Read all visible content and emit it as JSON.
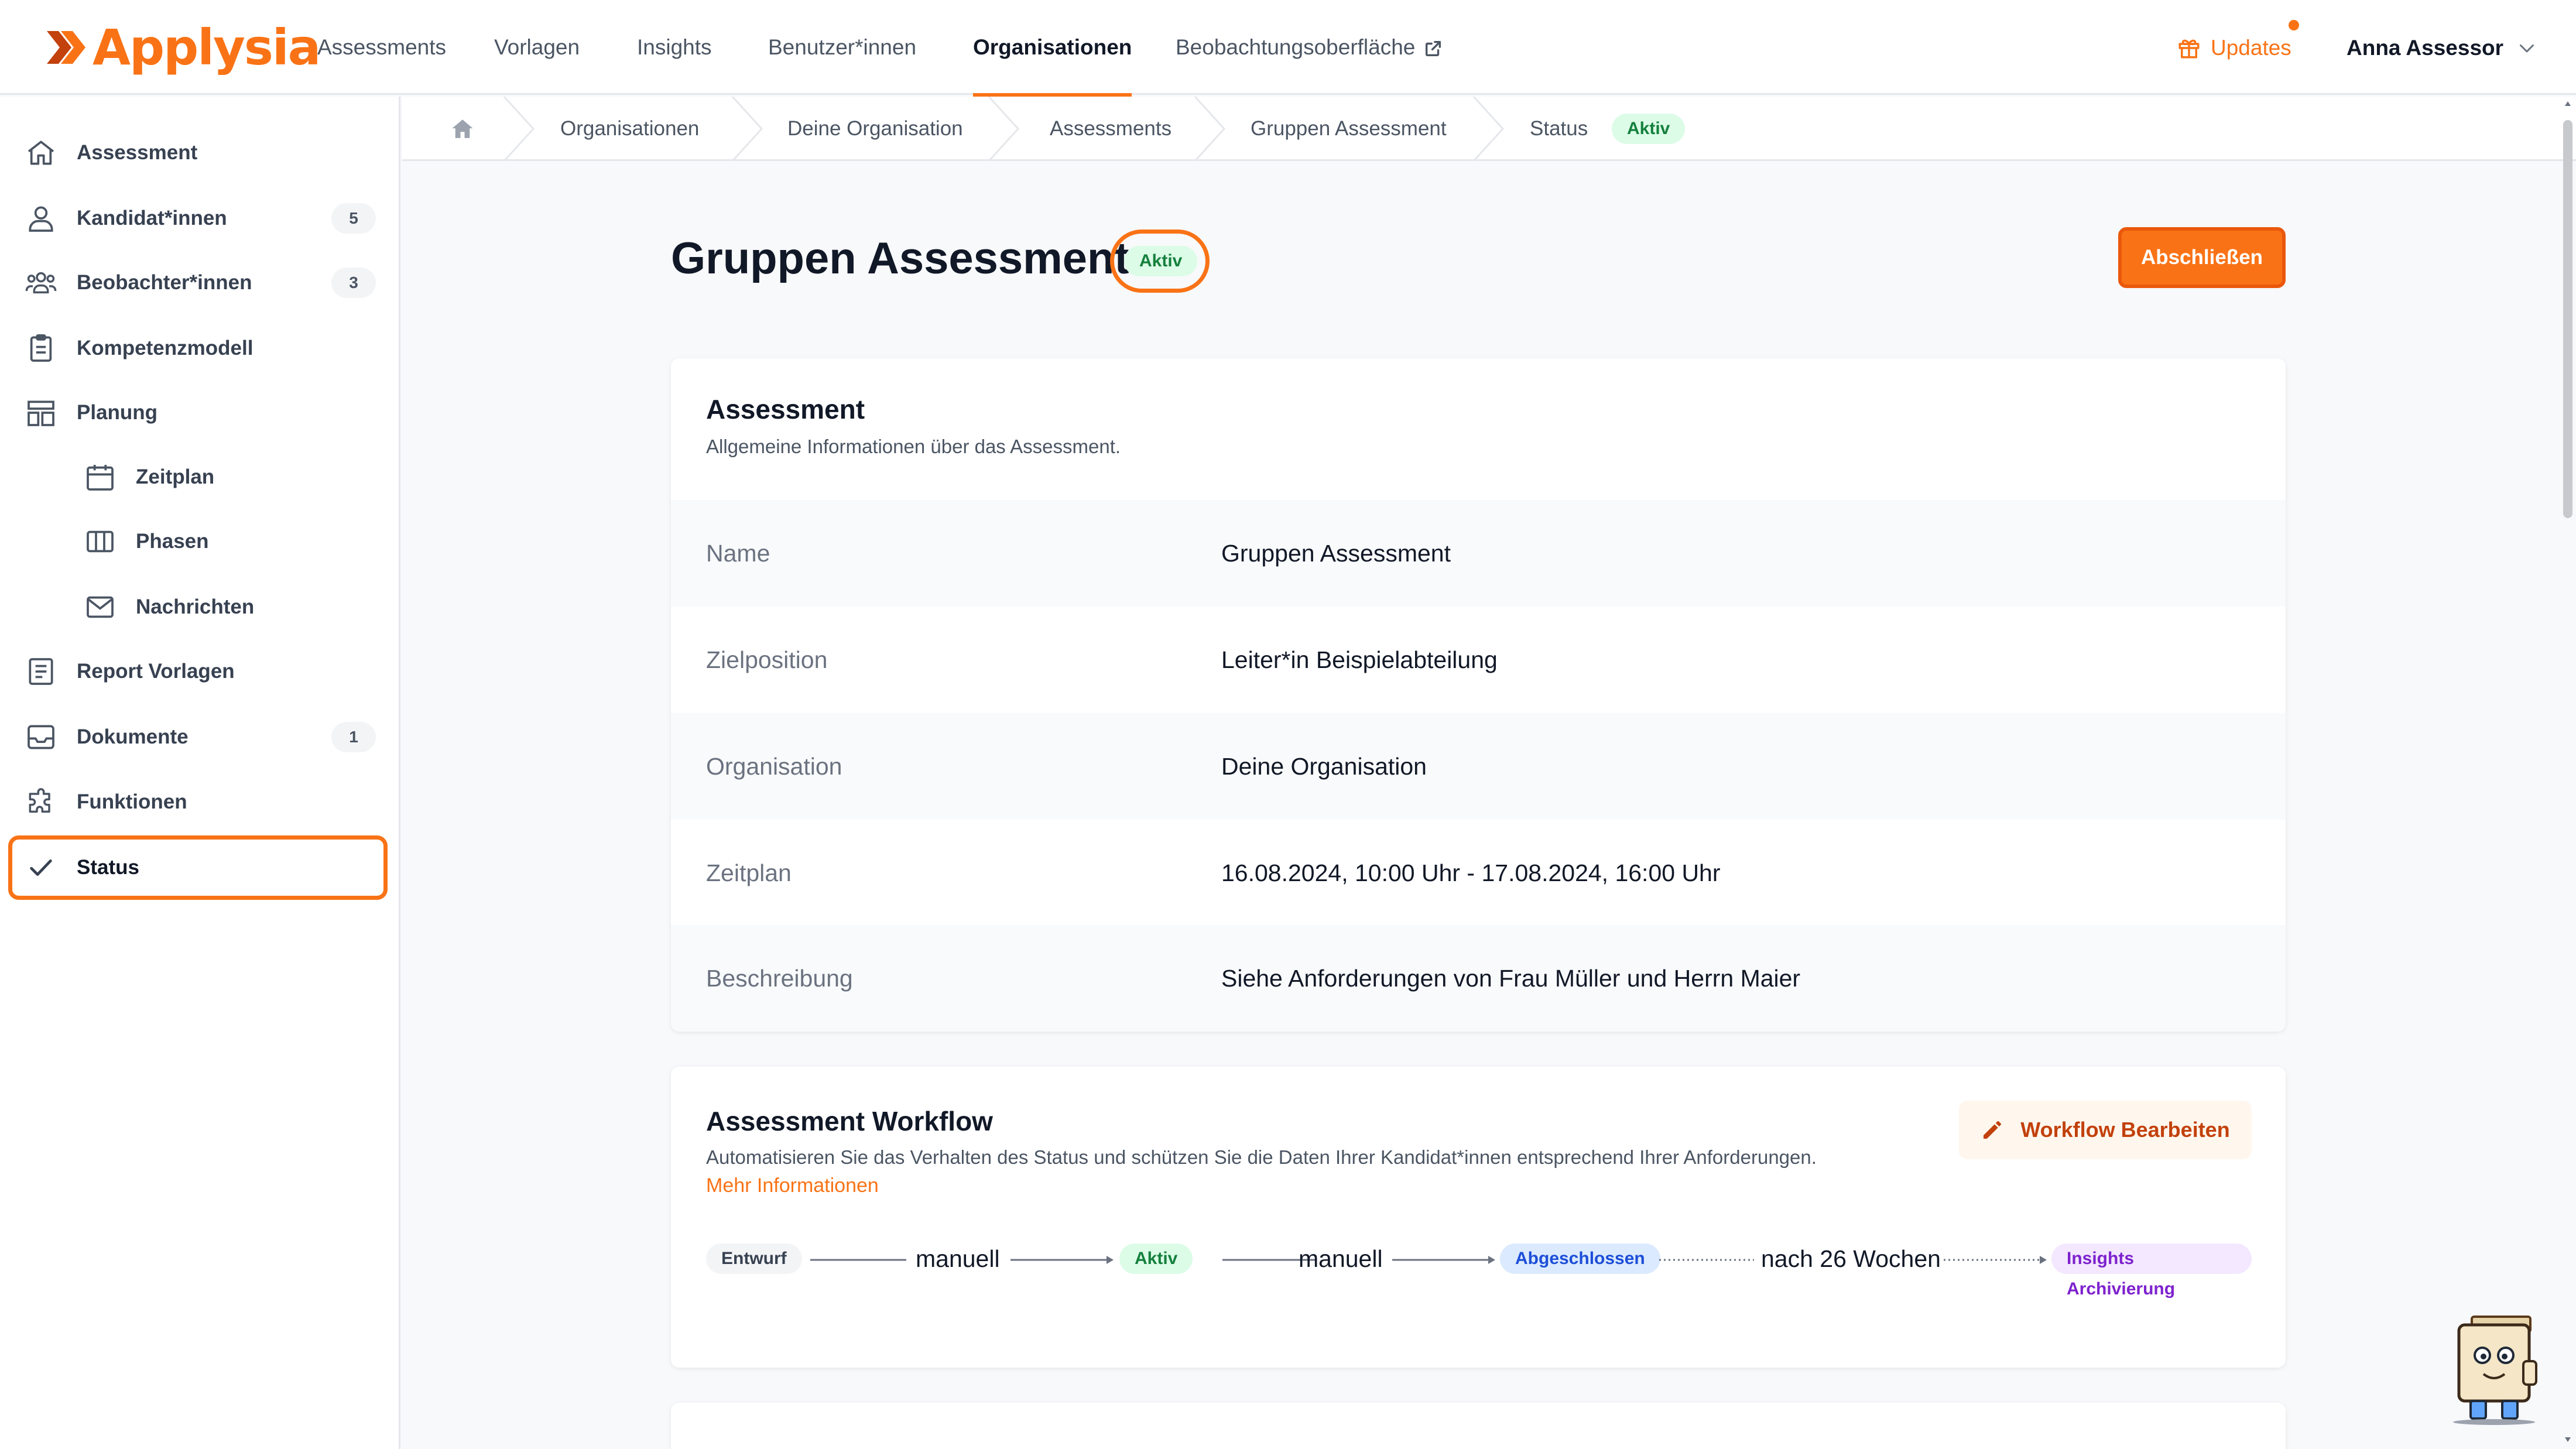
{
  "brand": {
    "name_first": "A",
    "name_rest": "pplysia",
    "accent": "#f97316"
  },
  "topnav": {
    "items": [
      "Assessments",
      "Vorlagen",
      "Insights",
      "Benutzer*innen",
      "Organisationen",
      "Beobachtungsoberfläche"
    ],
    "active": "Organisationen",
    "updates_label": "Updates",
    "user_name": "Anna Assessor"
  },
  "sidebar": {
    "items": [
      {
        "label": "Assessment",
        "icon": "home-icon"
      },
      {
        "label": "Kandidat*innen",
        "icon": "user-icon",
        "badge": "5"
      },
      {
        "label": "Beobachter*innen",
        "icon": "users-icon",
        "badge": "3"
      },
      {
        "label": "Kompetenzmodell",
        "icon": "clipboard-icon"
      },
      {
        "label": "Planung",
        "icon": "layout-icon"
      },
      {
        "label": "Zeitplan",
        "icon": "calendar-icon"
      },
      {
        "label": "Phasen",
        "icon": "columns-icon"
      },
      {
        "label": "Nachrichten",
        "icon": "mail-icon"
      },
      {
        "label": "Report Vorlagen",
        "icon": "report-icon"
      },
      {
        "label": "Dokumente",
        "icon": "inbox-icon",
        "badge": "1"
      },
      {
        "label": "Funktionen",
        "icon": "puzzle-icon"
      },
      {
        "label": "Status",
        "icon": "check-icon"
      }
    ],
    "active": "Status"
  },
  "breadcrumb": {
    "items": [
      "Organisationen",
      "Deine Organisation",
      "Assessments",
      "Gruppen Assessment",
      "Status"
    ],
    "status_pill": "Aktiv"
  },
  "page": {
    "title": "Gruppen Assessment",
    "status_pill": "Aktiv",
    "finish_button": "Abschließen"
  },
  "assessment_card": {
    "title": "Assessment",
    "subtitle": "Allgemeine Informationen über das Assessment.",
    "rows": [
      {
        "key": "Name",
        "value": "Gruppen Assessment"
      },
      {
        "key": "Zielposition",
        "value": "Leiter*in Beispielabteilung"
      },
      {
        "key": "Organisation",
        "value": "Deine Organisation"
      },
      {
        "key": "Zeitplan",
        "value": "16.08.2024, 10:00 Uhr - 17.08.2024, 16:00 Uhr"
      },
      {
        "key": "Beschreibung",
        "value": "Siehe Anforderungen von Frau Müller und Herrn Maier"
      }
    ]
  },
  "workflow_card": {
    "title": "Assessment Workflow",
    "subtitle": "Automatisieren Sie das Verhalten des Status und schützen Sie die Daten Ihrer Kandidat*innen entsprechend Ihrer Anforderungen.",
    "more_link": "Mehr Informationen",
    "edit_button": "Workflow Bearbeiten",
    "flow": {
      "states": [
        "Entwurf",
        "Aktiv",
        "Abgeschlossen",
        "Insights Archivierung"
      ],
      "triggers": [
        "manuell",
        "manuell",
        "nach 26 Wochen"
      ]
    }
  },
  "colors": {
    "accent": "#f97316",
    "green": "#15803d",
    "blue": "#1d4ed8",
    "purple": "#7e22ce"
  }
}
